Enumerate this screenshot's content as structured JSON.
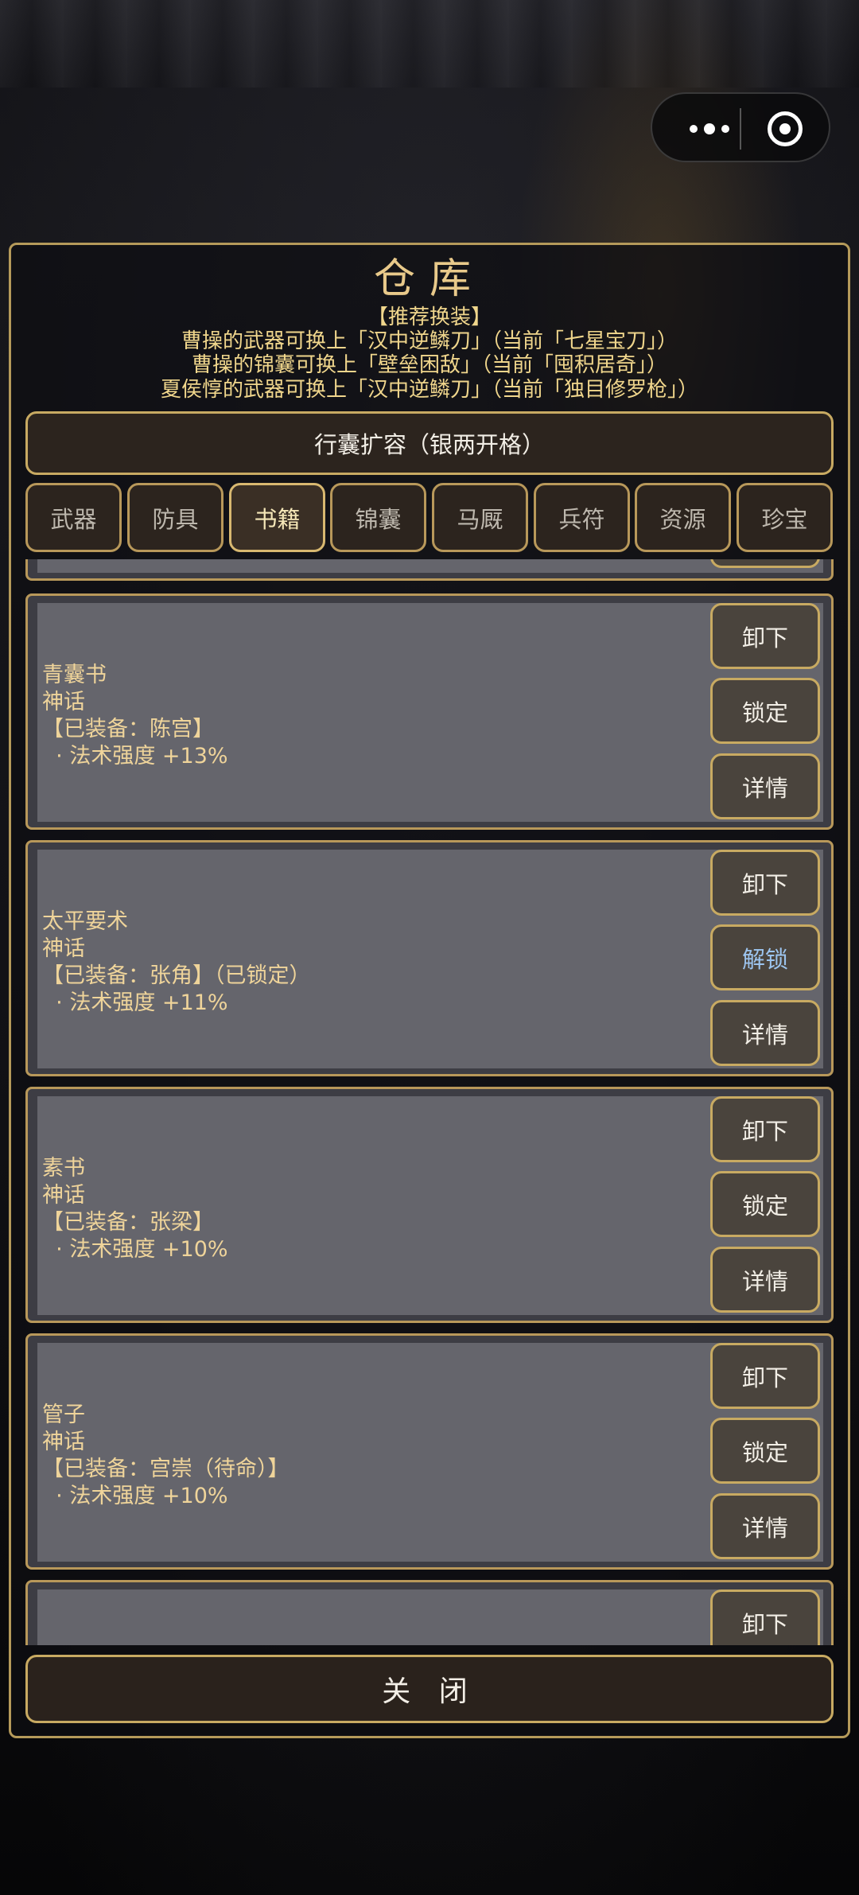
{
  "window": {
    "title": "仓库",
    "recommend_heading": "【推荐换装】",
    "recommendations": [
      "曹操的武器可换上「汉中逆鳞刀」（当前「七星宝刀」）",
      "曹操的锦囊可换上「壁垒困敌」（当前「囤积居奇」）",
      "夏侯惇的武器可换上「汉中逆鳞刀」（当前「独目修罗枪」）"
    ],
    "expand_label": "行囊扩容（银两开格）",
    "close_label": "关 闭"
  },
  "tabs": [
    {
      "label": "武器"
    },
    {
      "label": "防具"
    },
    {
      "label": "书籍",
      "active": true
    },
    {
      "label": "锦囊"
    },
    {
      "label": "马厩"
    },
    {
      "label": "兵符"
    },
    {
      "label": "资源"
    },
    {
      "label": "珍宝"
    }
  ],
  "items": [
    {
      "name": "青囊书",
      "rarity": "神话",
      "equip": "【已装备：陈宫】",
      "stat": "  · 法术强度 +13%",
      "buttons": [
        "卸下",
        "锁定",
        "详情"
      ]
    },
    {
      "name": "太平要术",
      "rarity": "神话",
      "equip": "【已装备：张角】（已锁定）",
      "stat": "  · 法术强度 +11%",
      "buttons": [
        "卸下",
        "解锁",
        "详情"
      ]
    },
    {
      "name": "素书",
      "rarity": "神话",
      "equip": "【已装备：张梁】",
      "stat": "  · 法术强度 +10%",
      "buttons": [
        "卸下",
        "锁定",
        "详情"
      ]
    },
    {
      "name": "管子",
      "rarity": "神话",
      "equip": "【已装备：宫崇（待命）】",
      "stat": "  · 法术强度 +10%",
      "buttons": [
        "卸下",
        "锁定",
        "详情"
      ]
    },
    {
      "buttons": [
        "卸下"
      ]
    }
  ],
  "colors": {
    "accent_gold": "#c8aa62",
    "title_gold": "#e8c98a",
    "unlock_blue": "#9cc4ee"
  }
}
